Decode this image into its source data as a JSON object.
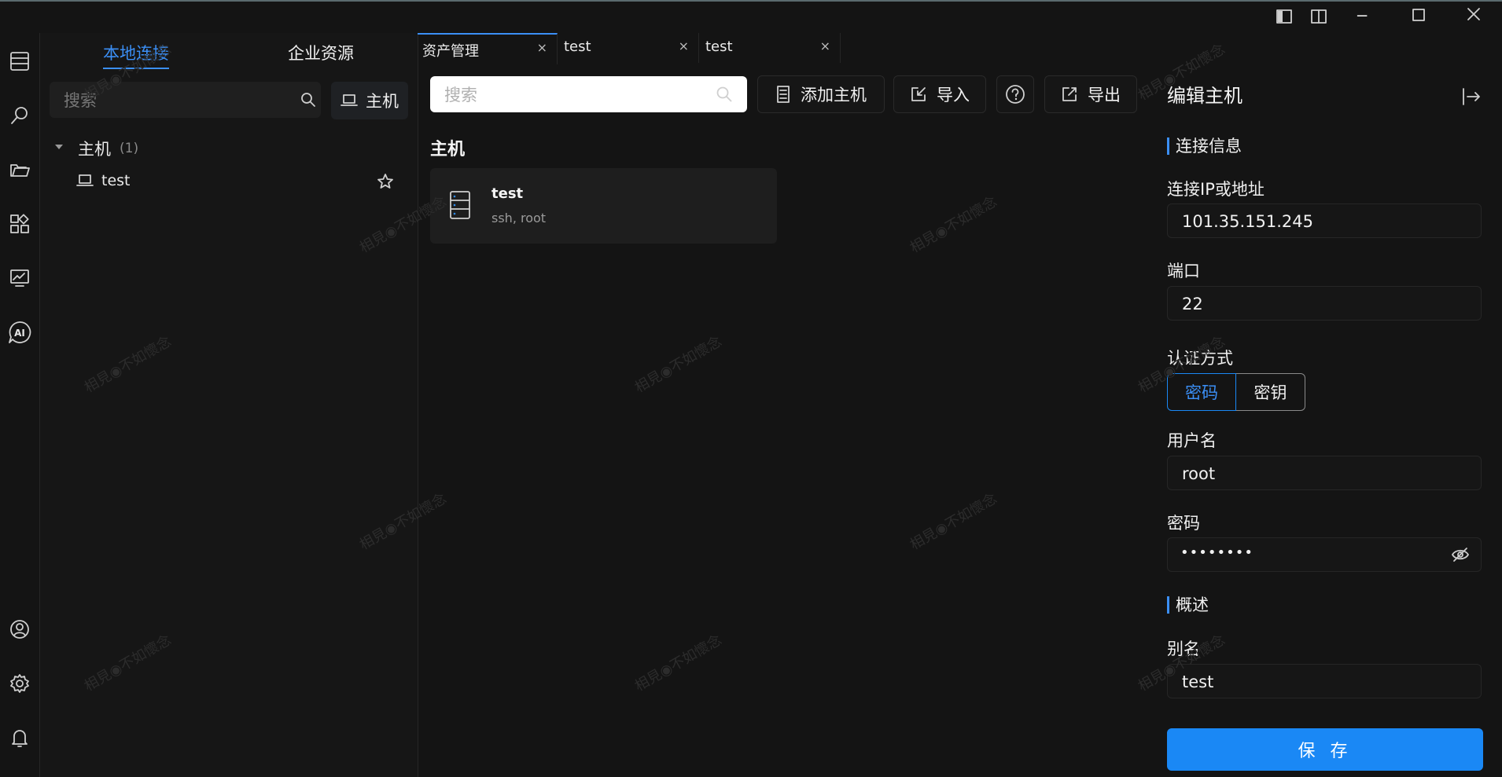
{
  "watermark": "相見◉不如懷念",
  "window_controls": {
    "layout_left_icon": "sidebar-left-icon",
    "layout_split_icon": "split-view-icon",
    "minimize": "─",
    "maximize": "☐",
    "close": "✕"
  },
  "rail": {
    "top_icons": [
      "hosts-list-icon",
      "search-icon",
      "folder-icon",
      "apps-icon",
      "monitor-icon",
      "ai-chat-icon"
    ],
    "bottom_icons": [
      "user-icon",
      "gear-icon",
      "bell-icon"
    ],
    "ai_label": "AI"
  },
  "sidebar": {
    "tabs": [
      "本地连接",
      "企业资源"
    ],
    "search_placeholder": "搜索",
    "host_button_label": "主机",
    "tree": {
      "group_label": "主机",
      "group_count": "(1)",
      "items": [
        {
          "label": "test"
        }
      ]
    }
  },
  "tabs": [
    {
      "label": "资产管理",
      "close": "×"
    },
    {
      "label": "test",
      "close": "×"
    },
    {
      "label": "test",
      "close": "×"
    }
  ],
  "toolbar": {
    "search_placeholder": "搜索",
    "add_host": "添加主机",
    "import": "导入",
    "export": "导出"
  },
  "main": {
    "section_title": "主机",
    "hosts": [
      {
        "name": "test",
        "detail": "ssh, root"
      }
    ]
  },
  "panel": {
    "title": "编辑主机",
    "section_connection": "连接信息",
    "ip_label": "连接IP或地址",
    "ip_value": "101.35.151.245",
    "port_label": "端口",
    "port_value": "22",
    "auth_label": "认证方式",
    "auth_options": [
      "密码",
      "密钥"
    ],
    "username_label": "用户名",
    "username_value": "root",
    "password_label": "密码",
    "password_value": "••••••••",
    "section_overview": "概述",
    "alias_label": "别名",
    "alias_value": "test",
    "save": "保 存"
  },
  "colors": {
    "accent": "#1a88f5",
    "background": "#141414"
  }
}
